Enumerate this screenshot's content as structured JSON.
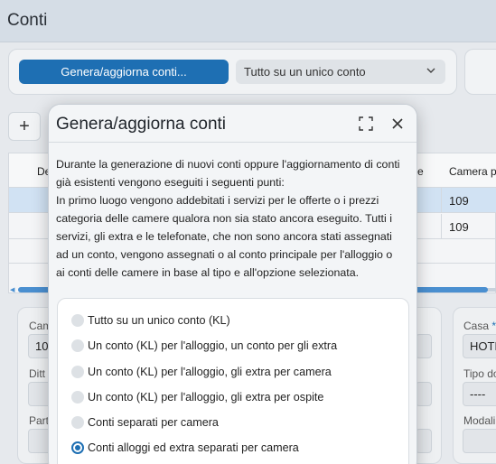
{
  "window": {
    "title": "Conti"
  },
  "toolbar": {
    "generate_label": "Genera/aggiorna conti...",
    "mode_select_value": "Tutto su un unico conto"
  },
  "grid": {
    "add_label": "+",
    "headers": [
      "De",
      "e",
      "Camera p"
    ],
    "rows": [
      {
        "camera": "109"
      },
      {
        "camera": "109"
      }
    ]
  },
  "form": {
    "left": {
      "field1_label": "Cam",
      "field1_value": "10",
      "field2_label": "Ditt",
      "field3_label": "Part"
    },
    "right": {
      "casa_label": "Casa",
      "casa_required": "*",
      "casa_value": "HOTE",
      "tipo_label": "Tipo do",
      "tipo_value": "----",
      "modal_label": "Modali"
    }
  },
  "dialog": {
    "title": "Genera/aggiorna conti",
    "description_lines": [
      "Durante la generazione di nuovi conti oppure l'aggiornamento di conti",
      "già esistenti vengono eseguiti i seguenti punti:",
      "In primo luogo vengono addebitati i servizi per le offerte o i prezzi",
      "categoria delle camere qualora non sia stato ancora eseguito. Tutti i",
      "servizi, gli extra e le telefonate, che non sono ancora stati assegnati",
      "ad un conto, vengono assegnati o al conto principale per l'alloggio o",
      "ai conti delle camere in base al tipo e all'opzione selezionata."
    ],
    "options": [
      {
        "label": "Tutto su un unico conto (KL)",
        "selected": false
      },
      {
        "label": "Un conto (KL) per l'alloggio, un conto per gli extra",
        "selected": false
      },
      {
        "label": "Un conto (KL) per l'alloggio, gli extra per camera",
        "selected": false
      },
      {
        "label": "Un conto (KL) per l'alloggio, gli extra per ospite",
        "selected": false
      },
      {
        "label": "Conti separati per camera",
        "selected": false
      },
      {
        "label": "Conti alloggi ed extra separati per camera",
        "selected": true
      }
    ]
  },
  "colors": {
    "accent": "#1e6fb3",
    "selected_row": "#d1e2f3"
  },
  "icons": {
    "expand": "expand-icon",
    "close": "close-icon",
    "chevron": "chevron-down-icon"
  }
}
